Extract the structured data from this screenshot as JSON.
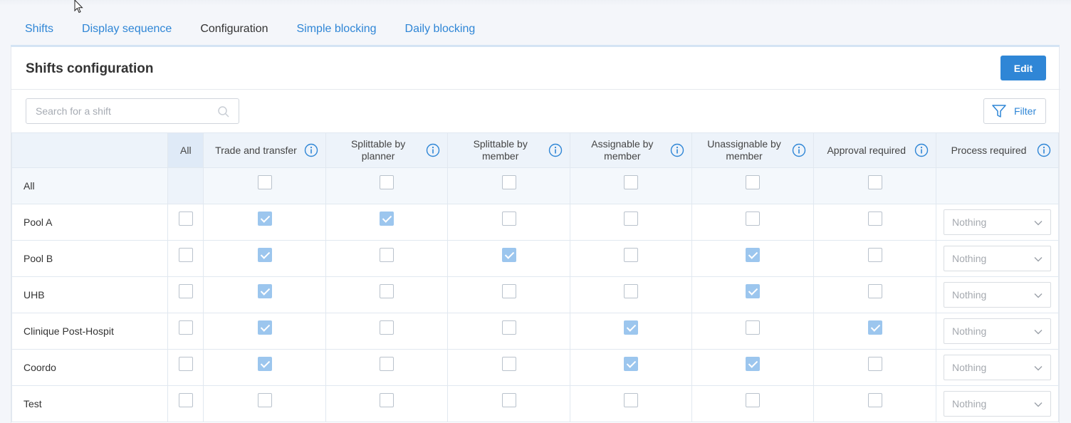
{
  "tabs": [
    {
      "label": "Shifts",
      "active": false
    },
    {
      "label": "Display sequence",
      "active": false
    },
    {
      "label": "Configuration",
      "active": true
    },
    {
      "label": "Simple blocking",
      "active": false
    },
    {
      "label": "Daily blocking",
      "active": false
    }
  ],
  "panel": {
    "title": "Shifts configuration",
    "edit_label": "Edit",
    "search_placeholder": "Search for a shift",
    "filter_label": "Filter"
  },
  "table": {
    "all_column_label": "All",
    "columns": [
      {
        "line1": "Trade and transfer",
        "line2": ""
      },
      {
        "line1": "Splittable by",
        "line2": "planner"
      },
      {
        "line1": "Splittable by",
        "line2": "member"
      },
      {
        "line1": "Assignable by",
        "line2": "member"
      },
      {
        "line1": "Unassignable by",
        "line2": "member"
      },
      {
        "line1": "Approval required",
        "line2": ""
      },
      {
        "line1": "Process required",
        "line2": ""
      }
    ],
    "all_row_label": "All",
    "rows": [
      {
        "name": "Pool A",
        "all": false,
        "flags": [
          true,
          true,
          false,
          false,
          false,
          false
        ],
        "process": "Nothing"
      },
      {
        "name": "Pool B",
        "all": false,
        "flags": [
          true,
          false,
          true,
          false,
          true,
          false
        ],
        "process": "Nothing"
      },
      {
        "name": "UHB",
        "all": false,
        "flags": [
          true,
          false,
          false,
          false,
          true,
          false
        ],
        "process": "Nothing"
      },
      {
        "name": "Clinique Post-Hospit",
        "all": false,
        "flags": [
          true,
          false,
          false,
          true,
          false,
          true
        ],
        "process": "Nothing"
      },
      {
        "name": "Coordo",
        "all": false,
        "flags": [
          true,
          false,
          false,
          true,
          true,
          false
        ],
        "process": "Nothing"
      },
      {
        "name": "Test",
        "all": false,
        "flags": [
          false,
          false,
          false,
          false,
          false,
          false
        ],
        "process": "Nothing"
      }
    ]
  },
  "colors": {
    "accent": "#2f86d6",
    "checked": "#9cc6ee",
    "header_bg": "#edf3fa"
  }
}
